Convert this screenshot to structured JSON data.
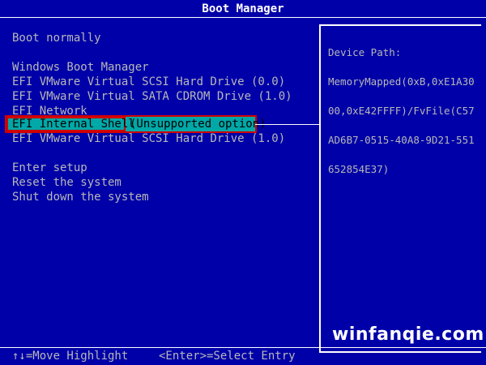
{
  "window": {
    "title": "Boot Manager"
  },
  "menu": {
    "boot_normally": "Boot normally",
    "section_label": "Windows Boot Manager",
    "items": [
      {
        "label": "EFI VMware Virtual SCSI Hard Drive (0.0)"
      },
      {
        "label": "EFI VMware Virtual SATA CDROM Drive (1.0)"
      },
      {
        "label": "EFI Network"
      },
      {
        "label": "EFI Internal Shell",
        "note": "(Unsupported option)",
        "selected": true
      },
      {
        "label": "EFI VMware Virtual SCSI Hard Drive (1.0)"
      }
    ],
    "actions": [
      {
        "label": "Enter setup"
      },
      {
        "label": "Reset the system"
      },
      {
        "label": "Shut down the system"
      }
    ]
  },
  "details": {
    "heading": "Device Path:",
    "lines": [
      "MemoryMapped(0xB,0xE1A30",
      "00,0xE42FFFF)/FvFile(C57",
      "AD6B7-0515-40A8-9D21-551",
      "652854E37)"
    ]
  },
  "footer": {
    "move_hint": "↑↓=Move Highlight",
    "select_hint": "<Enter>=Select Entry"
  },
  "watermark": "winfanqie.com",
  "colors": {
    "background": "#0000a8",
    "text": "#b8b8b8",
    "highlight": "#00a8a8",
    "accent_red": "#d00000",
    "title": "#ffffff"
  }
}
